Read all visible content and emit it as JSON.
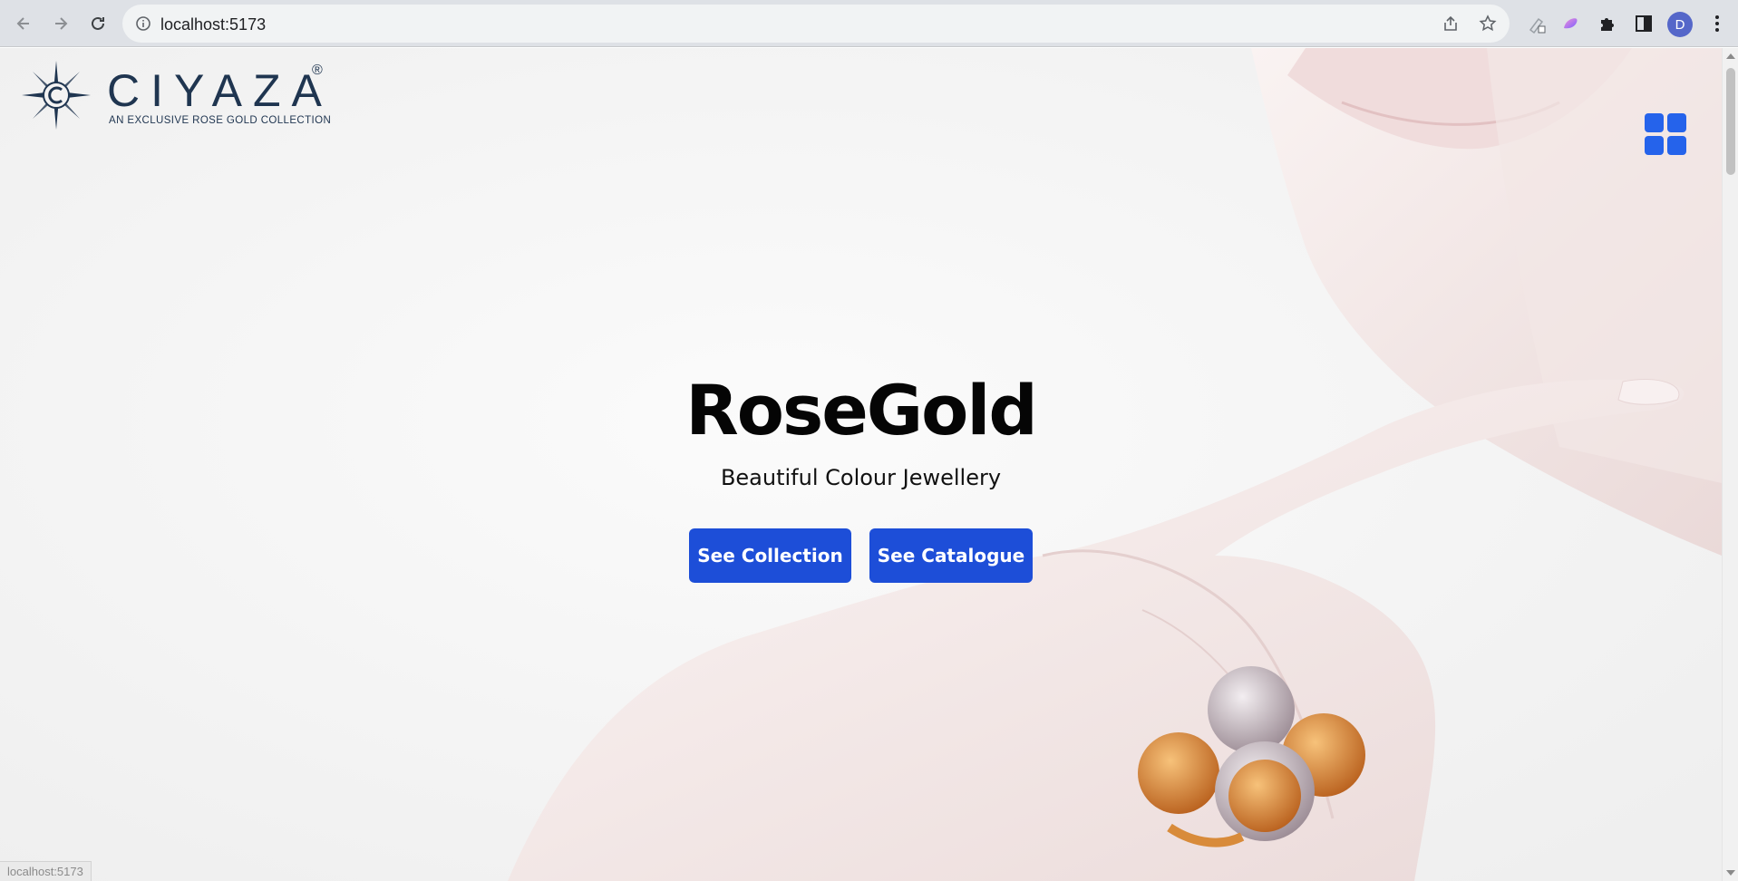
{
  "browser": {
    "url": "localhost:5173",
    "profile_initial": "D",
    "status_text": "localhost:5173"
  },
  "logo": {
    "wordmark": "CIYAZA",
    "registered": "®",
    "tagline": "AN EXCLUSIVE ROSE GOLD COLLECTION"
  },
  "hero": {
    "title": "RoseGold",
    "subtitle": "Beautiful Colour Jewellery"
  },
  "buttons": {
    "collection_label": "See Collection",
    "catalogue_label": "See Catalogue"
  },
  "colors": {
    "accent": "#1d4ed8",
    "menu_icon": "#2563eb",
    "logo": "#1f3550"
  },
  "icons": [
    "back-arrow-icon",
    "forward-arrow-icon",
    "reload-icon",
    "info-icon",
    "share-icon",
    "bookmark-star-icon",
    "extension-icon",
    "puzzle-icon",
    "side-panel-icon",
    "kebab-menu-icon",
    "grid-menu-icon"
  ]
}
